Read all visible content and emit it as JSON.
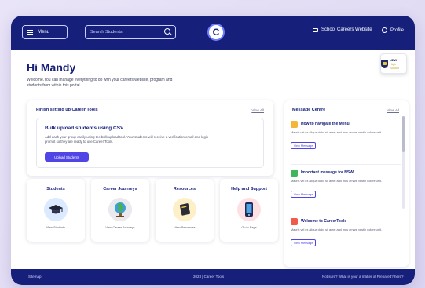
{
  "header": {
    "menu_label": "Menu",
    "search_placeholder": "Search Students",
    "logo_letter": "C",
    "school_website_label": "School Careers Website",
    "profile_label": "Profile"
  },
  "greeting": {
    "title": "Hi Mandy",
    "subtitle": "Welcome.You can manage everything to do with your careers website, program and students from within this portal."
  },
  "school_logo": {
    "line1": "NEW",
    "line2": "High School"
  },
  "setup": {
    "title": "Finish setting up Career Tools",
    "view_all": "View All",
    "task_title": "Bulk upload students using CSV",
    "task_desc": "Add each your group easily using the bulk upload tool. Your students will receive a verification email and login prompt so they are ready to use Career Tools.",
    "task_button": "Upload Students"
  },
  "tiles": [
    {
      "title": "Students",
      "link": "View Students",
      "icon": "graduation-cap-icon",
      "bg": "#dbeafe"
    },
    {
      "title": "Career Journeys",
      "link": "View Career Journeys",
      "icon": "globe-icon",
      "bg": "#e9e9ee"
    },
    {
      "title": "Resources",
      "link": "View Resources",
      "icon": "book-icon",
      "bg": "#fdf0c8"
    },
    {
      "title": "Help and Support",
      "link": "Go to Page",
      "icon": "phone-icon",
      "bg": "#fde0e3"
    }
  ],
  "messages": {
    "title": "Message Centre",
    "view_all": "View All",
    "items": [
      {
        "title": "How to navigate the Menu",
        "body": "Mauris vel ex aliqua dolor sit amet and mas ornare vestib dolore unit.",
        "button": "View Message",
        "color": "#f4b63a"
      },
      {
        "title": "Important message for NSW",
        "body": "Mauris vel ex aliqua dolor sit amet and mas ornare vestib dolore unit.",
        "button": "View Message",
        "color": "#3fb65c"
      },
      {
        "title": "Welcome to CareerTools",
        "body": "Mauris vel ex aliqua dolor sit amet and mas ornare vestib dolore unit.",
        "button": "View Message",
        "color": "#ee5b4a"
      }
    ]
  },
  "footer": {
    "left": "Sitemap",
    "center": "2023 | Career Tools",
    "right": "Not sure? What is your a matter of Prepared? here?"
  }
}
